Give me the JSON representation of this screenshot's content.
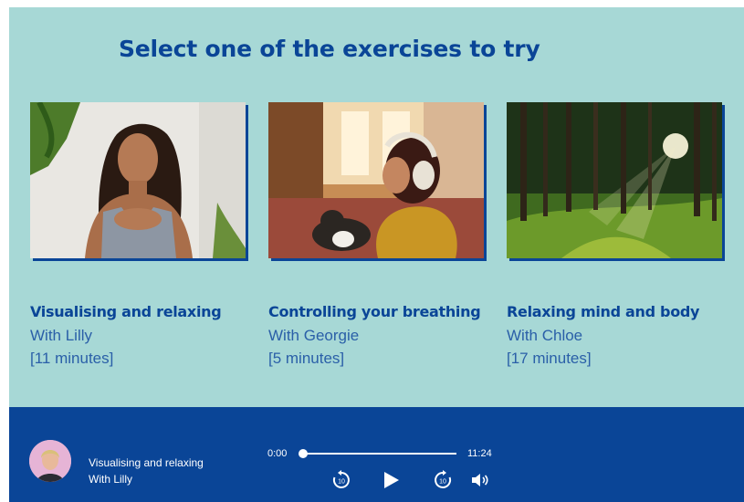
{
  "page": {
    "heading": "Select one of the exercises to try"
  },
  "exercises": [
    {
      "title": "Visualising and relaxing",
      "host": "With Lilly",
      "duration": "[11 minutes]",
      "image": "woman-meditating-photo"
    },
    {
      "title": "Controlling your breathing",
      "host": "With Georgie",
      "duration": "[5 minutes]",
      "image": "woman-headphones-cat-photo"
    },
    {
      "title": "Relaxing mind and body",
      "host": "With Chloe",
      "duration": "[17 minutes]",
      "image": "forest-sunlight-photo"
    }
  ],
  "player": {
    "track_title": "Visualising and relaxing",
    "track_host": "With Lilly",
    "current_time": "0:00",
    "total_time": "11:24",
    "progress": 0,
    "controls": [
      "rewind-10-icon",
      "play-icon",
      "forward-10-icon",
      "volume-icon"
    ]
  },
  "colors": {
    "background": "#a7d8d6",
    "brand_blue": "#0a4597",
    "text_blue": "#2a5fa8"
  }
}
